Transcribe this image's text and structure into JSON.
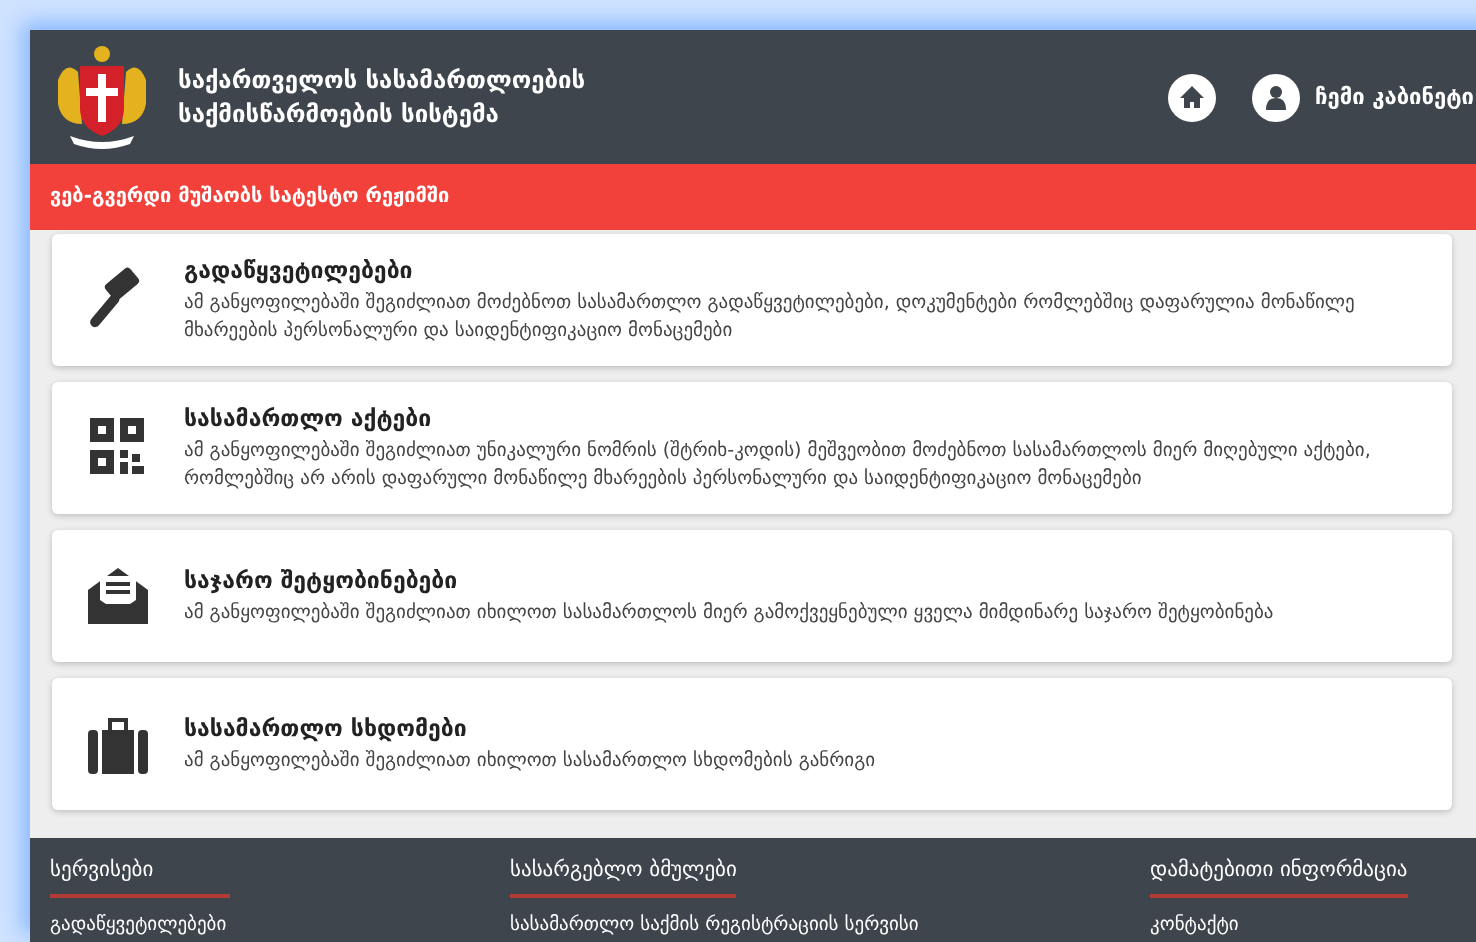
{
  "header": {
    "title_lines": [
      "საქართველოს სასამართლოების",
      "საქმისწარმოების სისტემა"
    ],
    "cabinet_label": "ჩემი კაბინეტი"
  },
  "banner": {
    "text": "ვებ-გვერდი მუშაობს სატესტო რეჟიმში"
  },
  "cards": [
    {
      "kind": "gavel",
      "title": "გადაწყვეტილებები",
      "description": "ამ განყოფილებაში შეგიძლიათ მოძებნოთ სასამართლო გადაწყვეტილებები, დოკუმენტები რომლებშიც დაფარულია მონაწილე მხარეების პერსონალური და საიდენტიფიკაციო მონაცემები"
    },
    {
      "kind": "qr",
      "title": "სასამართლო აქტები",
      "description": "ამ განყოფილებაში შეგიძლიათ უნიკალური ნომრის (შტრიხ-კოდის) მეშვეობით მოძებნოთ სასამართლოს მიერ მიღებული აქტები, რომლებშიც არ არის დაფარული მონაწილე მხარეების პერსონალური და საიდენტიფიკაციო მონაცემები"
    },
    {
      "kind": "envelope",
      "title": "საჯარო შეტყობინებები",
      "description": "ამ განყოფილებაში შეგიძლიათ იხილოთ სასამართლოს მიერ გამოქვეყნებული ყველა მიმდინარე საჯარო შეტყობინება"
    },
    {
      "kind": "suitcase",
      "title": "სასამართლო სხდომები",
      "description": "ამ განყოფილებაში შეგიძლიათ იხილოთ სასამართლო სხდომების განრიგი"
    }
  ],
  "footer": {
    "columns": [
      {
        "heading": "სერვისები",
        "links": [
          "გადაწყვეტილებები"
        ]
      },
      {
        "heading": "სასარგებლო ბმულები",
        "links": [
          "სასამართლო საქმის რეგისტრაციის სერვისი"
        ]
      },
      {
        "heading": "დამატებითი ინფორმაცია",
        "links": [
          "კონტაქტი"
        ]
      }
    ]
  }
}
